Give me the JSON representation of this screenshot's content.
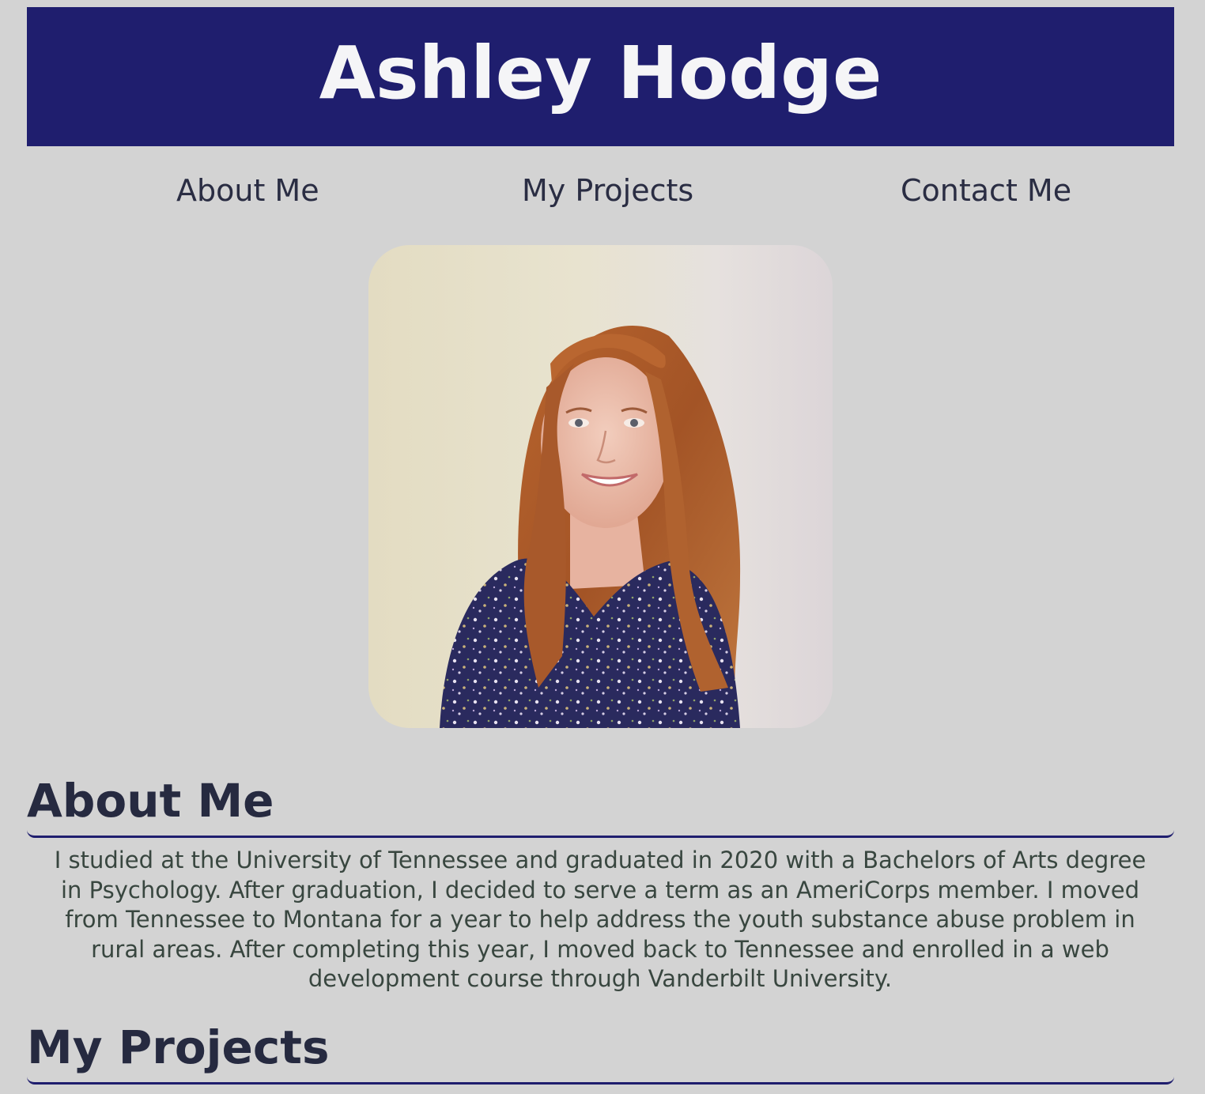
{
  "header": {
    "title": "Ashley Hodge",
    "background_color": "#1f1e6e",
    "text_color": "#f5f5f7"
  },
  "nav": {
    "items": [
      {
        "label": "About Me"
      },
      {
        "label": "My Projects"
      },
      {
        "label": "Contact Me"
      }
    ]
  },
  "profile_photo": {
    "description_icon": "profile-photo"
  },
  "about": {
    "heading": "About Me",
    "body": "I studied at the University of Tennessee and graduated in 2020 with a Bachelors of Arts degree in Psychology. After graduation, I decided to serve a term as an AmeriCorps member. I moved from Tennessee to Montana for a year to help address the youth substance abuse problem in rural areas. After completing this year, I moved back to Tennessee and enrolled in a web development course through Vanderbilt University."
  },
  "projects": {
    "heading": "My Projects"
  },
  "colors": {
    "page_background": "#d3d3d3",
    "accent": "#1f1e6e",
    "heading_text": "#262a40",
    "body_text": "#38463f"
  }
}
